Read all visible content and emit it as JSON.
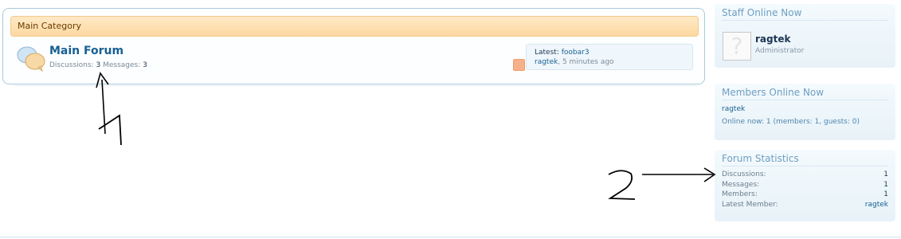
{
  "category": {
    "title": "Main Category"
  },
  "forum": {
    "title": "Main Forum",
    "discussions_label": "Discussions:",
    "discussions_value": "3",
    "messages_label": "Messages:",
    "messages_value": "3",
    "latest_label": "Latest:",
    "latest_thread": "foobar3",
    "latest_user": "ragtek",
    "latest_time": ", 5 minutes ago"
  },
  "sidebar": {
    "staff": {
      "heading": "Staff Online Now",
      "name": "ragtek",
      "role": "Administrator",
      "avatar_glyph": "?"
    },
    "members": {
      "heading": "Members Online Now",
      "user": "ragtek",
      "summary": "Online now: 1 (members: 1, guests: 0)"
    },
    "stats": {
      "heading": "Forum Statistics",
      "rows": [
        {
          "label": "Discussions:",
          "value": "1"
        },
        {
          "label": "Messages:",
          "value": "1"
        },
        {
          "label": "Members:",
          "value": "1"
        },
        {
          "label": "Latest Member:",
          "value": "ragtek"
        }
      ]
    }
  },
  "annotations": {
    "one": "1",
    "two": "2"
  }
}
